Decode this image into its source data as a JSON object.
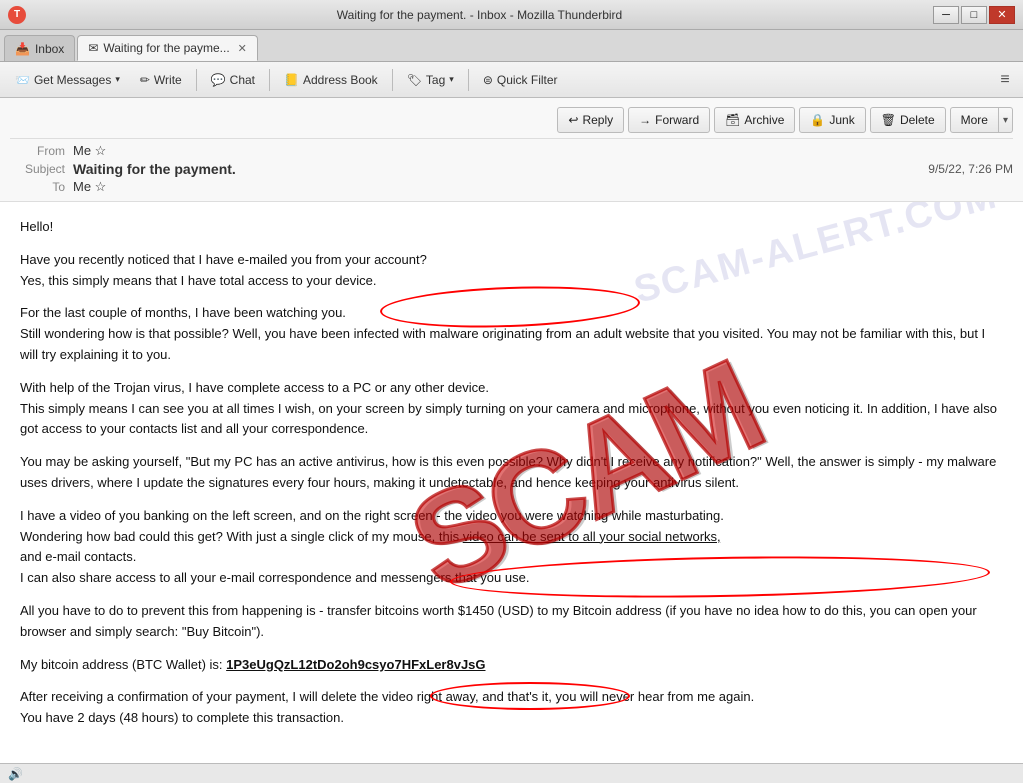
{
  "window": {
    "title": "Waiting for the payment. - Inbox - Mozilla Thunderbird",
    "controls": {
      "minimize": "─",
      "maximize": "□",
      "close": "✕"
    }
  },
  "tabs": [
    {
      "id": "inbox",
      "label": "Inbox",
      "icon": "📥",
      "active": false
    },
    {
      "id": "email",
      "label": "Waiting for the payme...",
      "icon": "✉",
      "active": true,
      "closeable": true
    }
  ],
  "toolbar": {
    "get_messages": "Get Messages",
    "write": "Write",
    "chat": "Chat",
    "address_book": "Address Book",
    "tag": "Tag",
    "quick_filter": "Quick Filter",
    "menu_icon": "≡"
  },
  "action_buttons": {
    "reply": {
      "label": "Reply",
      "icon": "↩"
    },
    "forward": {
      "label": "Forward",
      "icon": "→"
    },
    "archive": {
      "label": "Archive",
      "icon": "🗄"
    },
    "junk": {
      "label": "Junk",
      "icon": "🔒"
    },
    "delete": {
      "label": "Delete",
      "icon": "🗑"
    },
    "more": {
      "label": "More",
      "icon": "▾"
    }
  },
  "message": {
    "from_label": "From",
    "from": "Me ☆",
    "subject_label": "Subject",
    "subject": "Waiting for the payment.",
    "to_label": "To",
    "to": "Me ☆",
    "date": "9/5/22, 7:26 PM"
  },
  "email_body": {
    "greeting": "Hello!",
    "paragraphs": [
      "Have you recently noticed that I have e-mailed you from your account?\nYes, this simply means that I have total access to your device.",
      "For the last couple of months, I have been watching you.\nStill wondering how is that possible? Well, you have been infected with malware originating from an adult website that you visited. You may not be familiar with this, but I will try explaining it to you.",
      "With help of the Trojan virus, I have complete access to a PC or any other device.\nThis simply means I can see you at all times I wish, on your screen by simply turning on your camera and microphone, without you even noticing it. In addition, I have also got access to your contacts list and all your correspondence.",
      "You may be asking yourself, \"But my PC has an active antivirus, how is this even possible? Why didn't I receive any notification?\" Well, the answer is simply - my malware uses drivers, where I update the signatures every four hours, making it undetectable, and hence keeping your antivirus silent.",
      "I have a video of you banking on the left screen, and on the right screen - the video you were watching while masturbating.\nWondering how bad could this get? With just a single click of my mouse, this video can be sent to all your social networks, and e-mail contacts.\nI can also share access to all your e-mail correspondence and messengers that you use.",
      "All you have to do to prevent this from happening is - transfer bitcoins worth $1450 (USD) to my Bitcoin address (if you have no idea how to do this, you can open your browser and simply search: \"Buy Bitcoin\").",
      "My bitcoin address (BTC Wallet) is: 1P3eUgQzL12tDo2oh9csyo7HFxLer8vJsG",
      "After receiving a confirmation of your payment, I will delete the video right away, and that's it, you will never hear from me again.\nYou have 2 days (48 hours) to complete this transaction."
    ]
  },
  "scam_text": "SCAM",
  "watermark_text": "SCAM-ALERT.COM",
  "status_bar": {
    "icon": "🔊",
    "text": ""
  }
}
